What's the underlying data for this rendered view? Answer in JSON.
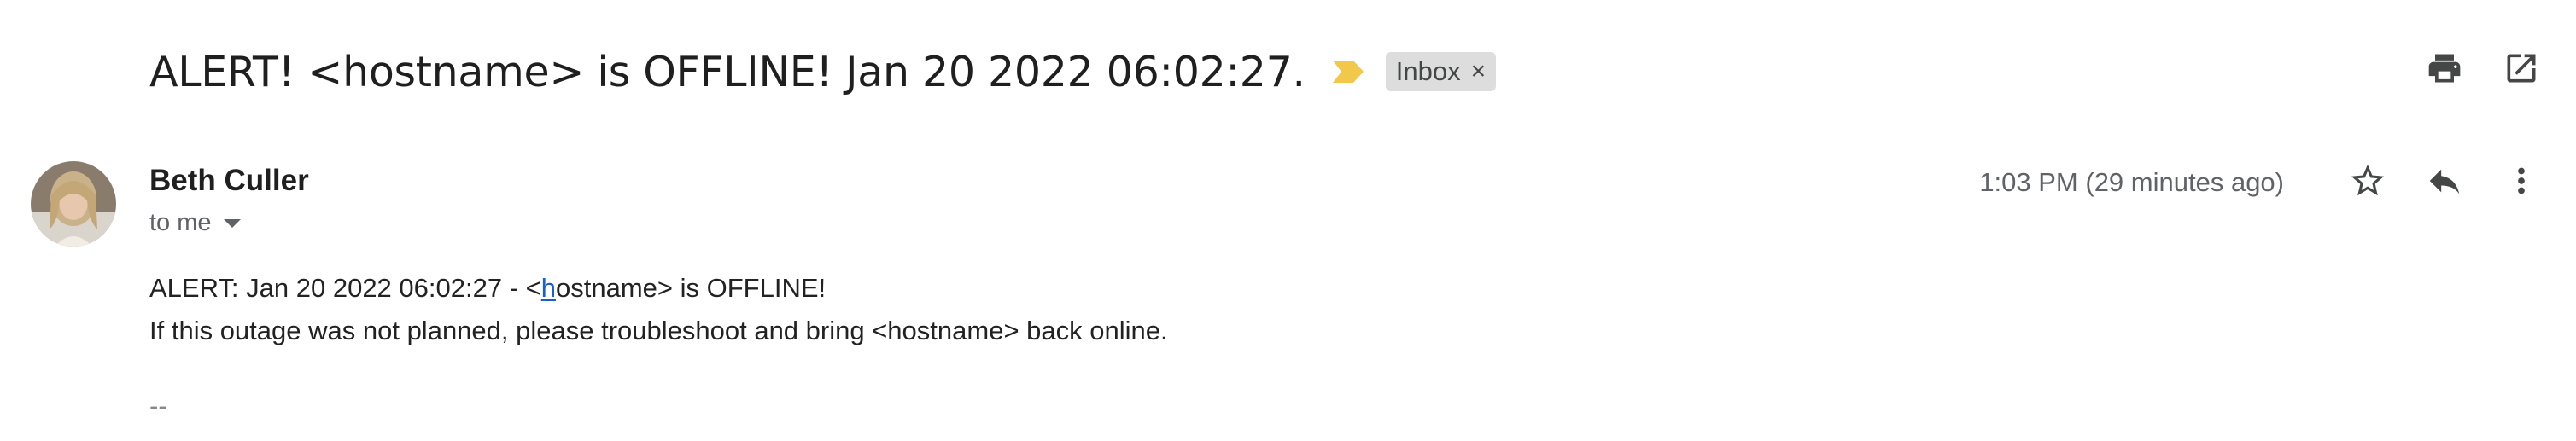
{
  "email": {
    "subject": "ALERT! <hostname> is OFFLINE! Jan 20 2022 06:02:27.",
    "label": "Inbox",
    "label_remove": "×",
    "sender_name": "Beth Culler",
    "recipient": "to me",
    "timestamp": "1:03 PM (29 minutes ago)",
    "body": {
      "line1_prefix": "ALERT: Jan 20 2022 06:02:27 - <",
      "line1_link": "h",
      "line1_suffix": "ostname> is OFFLINE!",
      "line2": "If this outage was not planned, please troubleshoot and bring <hostname> back online.",
      "signature_separator": "--"
    }
  },
  "icons": {
    "importance": "importance-marker-icon",
    "print": "print-icon",
    "new_window": "open-in-new-window-icon",
    "star": "star-icon",
    "reply": "reply-icon",
    "more": "more-vert-icon"
  },
  "colors": {
    "importance_marker": "#f2c84b",
    "label_chip_bg": "#dddddd",
    "link": "#1a5fd0",
    "icon": "#444746"
  }
}
